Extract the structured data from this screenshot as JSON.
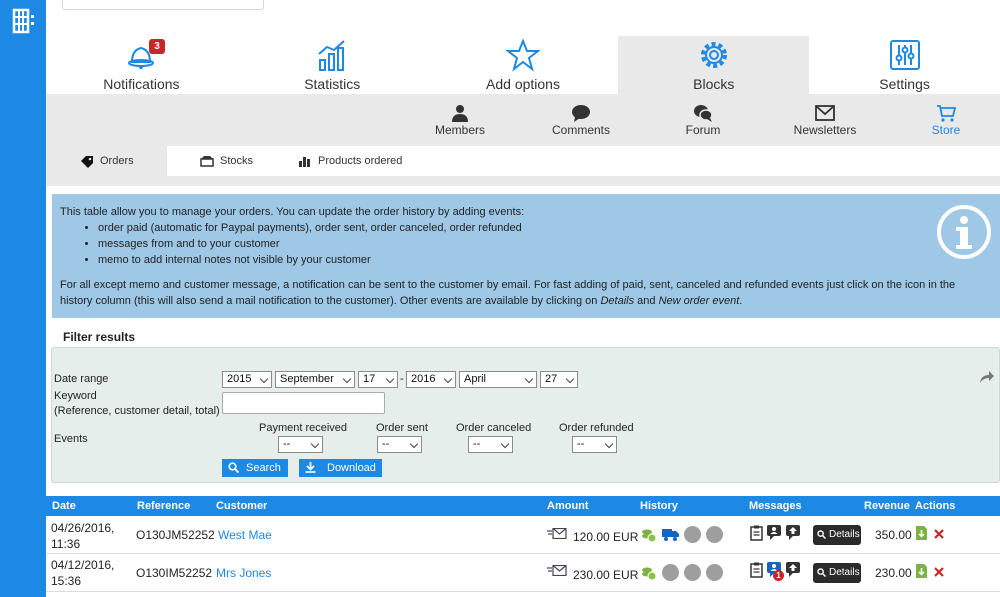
{
  "main_tabs": [
    {
      "label": "Notifications",
      "icon": "bell-icon",
      "badge": "3"
    },
    {
      "label": "Statistics",
      "icon": "bar-chart-icon"
    },
    {
      "label": "Add options",
      "icon": "star-icon"
    },
    {
      "label": "Blocks",
      "icon": "gear-icon",
      "active": true
    },
    {
      "label": "Settings",
      "icon": "sliders-icon"
    }
  ],
  "sub_tabs": [
    {
      "label": "Members",
      "icon": "user-icon"
    },
    {
      "label": "Comments",
      "icon": "speech-bubble-icon"
    },
    {
      "label": "Forum",
      "icon": "chat-bubbles-icon"
    },
    {
      "label": "Newsletters",
      "icon": "envelope-icon"
    },
    {
      "label": "Store",
      "icon": "cart-icon",
      "active": true
    }
  ],
  "store_tabs": [
    {
      "label": "Orders",
      "icon": "tag-icon",
      "active": true
    },
    {
      "label": "Stocks",
      "icon": "box-icon"
    },
    {
      "label": "Products ordered",
      "icon": "bar-chart-icon"
    }
  ],
  "info": {
    "intro": "This table allow you to manage your orders. You can update the order history by adding events:",
    "bullets": [
      "order paid (automatic for Paypal payments), order sent, order canceled, order refunded",
      "messages from and to your customer",
      "memo to add internal notes not visible by your customer"
    ],
    "para_start": "For all except memo and customer message, a notification can be sent to the customer by email. For fast adding of paid, sent, canceled and refunded events just click on the icon in the history column (this will also send a mail notification to the customer). Other events are available by clicking on ",
    "para_details": "Details",
    "para_and": " and ",
    "para_new_event": "New order event",
    "para_end": "."
  },
  "filter": {
    "title": "Filter results",
    "date_range_label": "Date range",
    "from_year": "2015",
    "from_month": "September",
    "from_day": "17",
    "dash": "-",
    "to_year": "2016",
    "to_month": "April",
    "to_day": "27",
    "keyword_label": "Keyword",
    "keyword_hint": "(Reference, customer detail, total)",
    "keyword_value": "",
    "events_label": "Events",
    "event_columns": [
      "Payment received",
      "Order sent",
      "Order canceled",
      "Order refunded"
    ],
    "event_value": "--",
    "search_label": "Search",
    "download_label": "Download"
  },
  "table": {
    "headers": {
      "date": "Date",
      "reference": "Reference",
      "customer": "Customer",
      "amount": "Amount",
      "history": "History",
      "messages": "Messages",
      "revenue": "Revenue",
      "actions": "Actions"
    },
    "details_label": "Details",
    "rows": [
      {
        "date": "04/26/2016,",
        "time": "11:36",
        "reference": "O130JM52252",
        "customer": "West Mae",
        "amount": "120.00 EUR",
        "revenue": "350.00",
        "message_badge": ""
      },
      {
        "date": "04/12/2016,",
        "time": "15:36",
        "reference": "O130IM52252",
        "customer": "Mrs Jones",
        "amount": "230.00 EUR",
        "revenue": "230.00",
        "message_badge": "1"
      }
    ]
  },
  "colors": {
    "accent": "#1e88e5",
    "info_bg": "#9ec8e6",
    "badge_red": "#c62828",
    "filter_bg": "#e6eeec"
  }
}
